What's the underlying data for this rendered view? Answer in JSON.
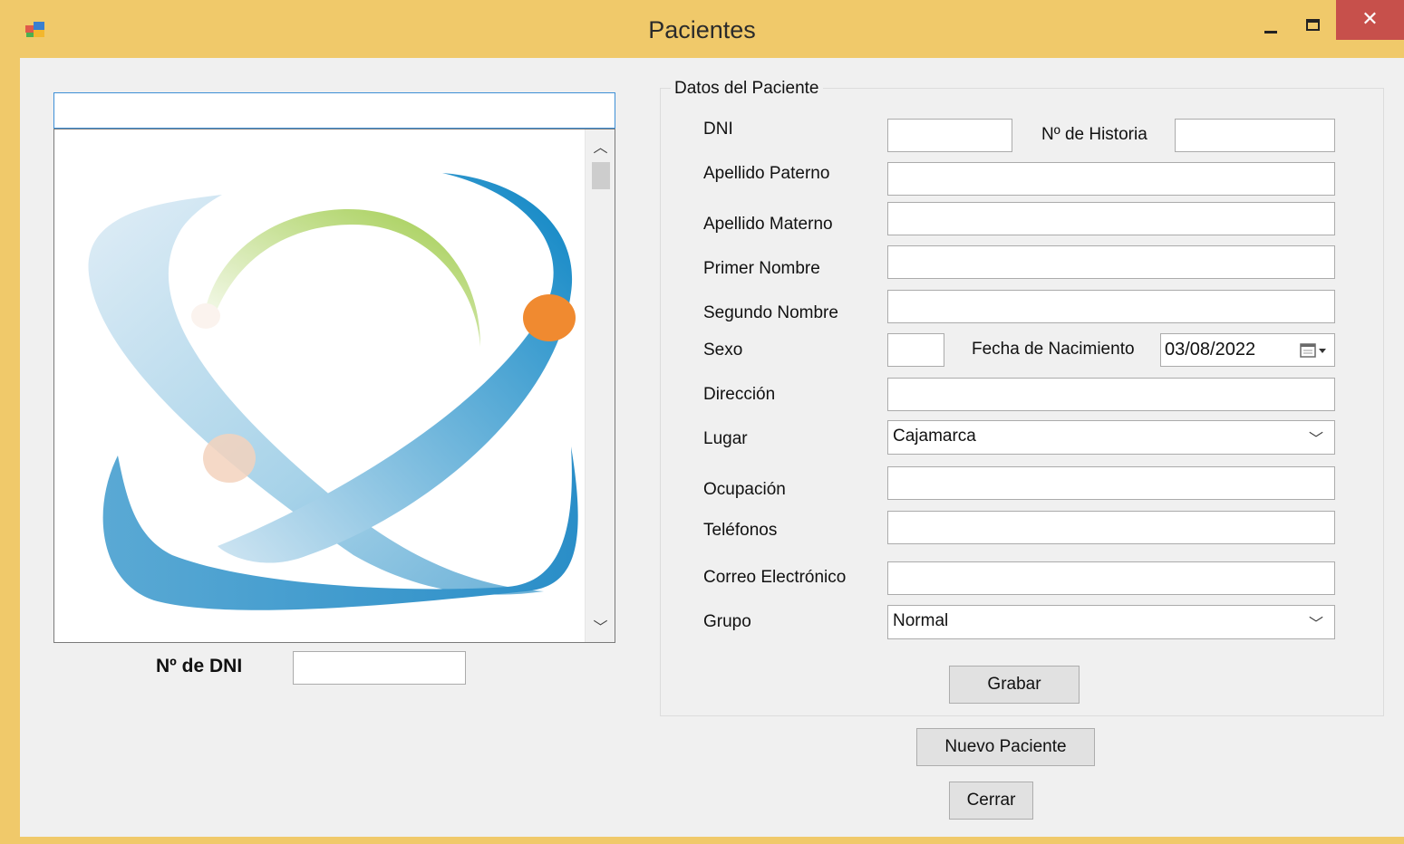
{
  "window": {
    "title": "Pacientes"
  },
  "left": {
    "search_value": "",
    "dni_label": "Nº de DNI",
    "dni_value": ""
  },
  "patient_form": {
    "group_title": "Datos del Paciente",
    "labels": {
      "dni": "DNI",
      "historia": "Nº de Historia",
      "apellido_paterno": "Apellido Paterno",
      "apellido_materno": "Apellido Materno",
      "primer_nombre": "Primer Nombre",
      "segundo_nombre": "Segundo Nombre",
      "sexo": "Sexo",
      "fecha_nacimiento": "Fecha de Nacimiento",
      "direccion": "Dirección",
      "lugar": "Lugar",
      "ocupacion": "Ocupación",
      "telefonos": "Teléfonos",
      "correo": "Correo Electrónico",
      "grupo": "Grupo"
    },
    "values": {
      "dni": "",
      "historia": "",
      "apellido_paterno": "",
      "apellido_materno": "",
      "primer_nombre": "",
      "segundo_nombre": "",
      "sexo": "",
      "fecha_nacimiento": "03/08/2022",
      "direccion": "",
      "lugar": "Cajamarca",
      "ocupacion": "",
      "telefonos": "",
      "correo": "",
      "grupo": "Normal"
    },
    "save_label": "Grabar"
  },
  "buttons": {
    "new_patient": "Nuevo Paciente",
    "close": "Cerrar"
  },
  "icons": {
    "app": "app-icon",
    "minimize": "minimize-icon",
    "maximize": "maximize-icon",
    "close": "close-icon",
    "calendar": "calendar-icon"
  },
  "colors": {
    "frame": "#f0c96a",
    "close_button": "#c7504b",
    "client": "#f0f0f0"
  }
}
